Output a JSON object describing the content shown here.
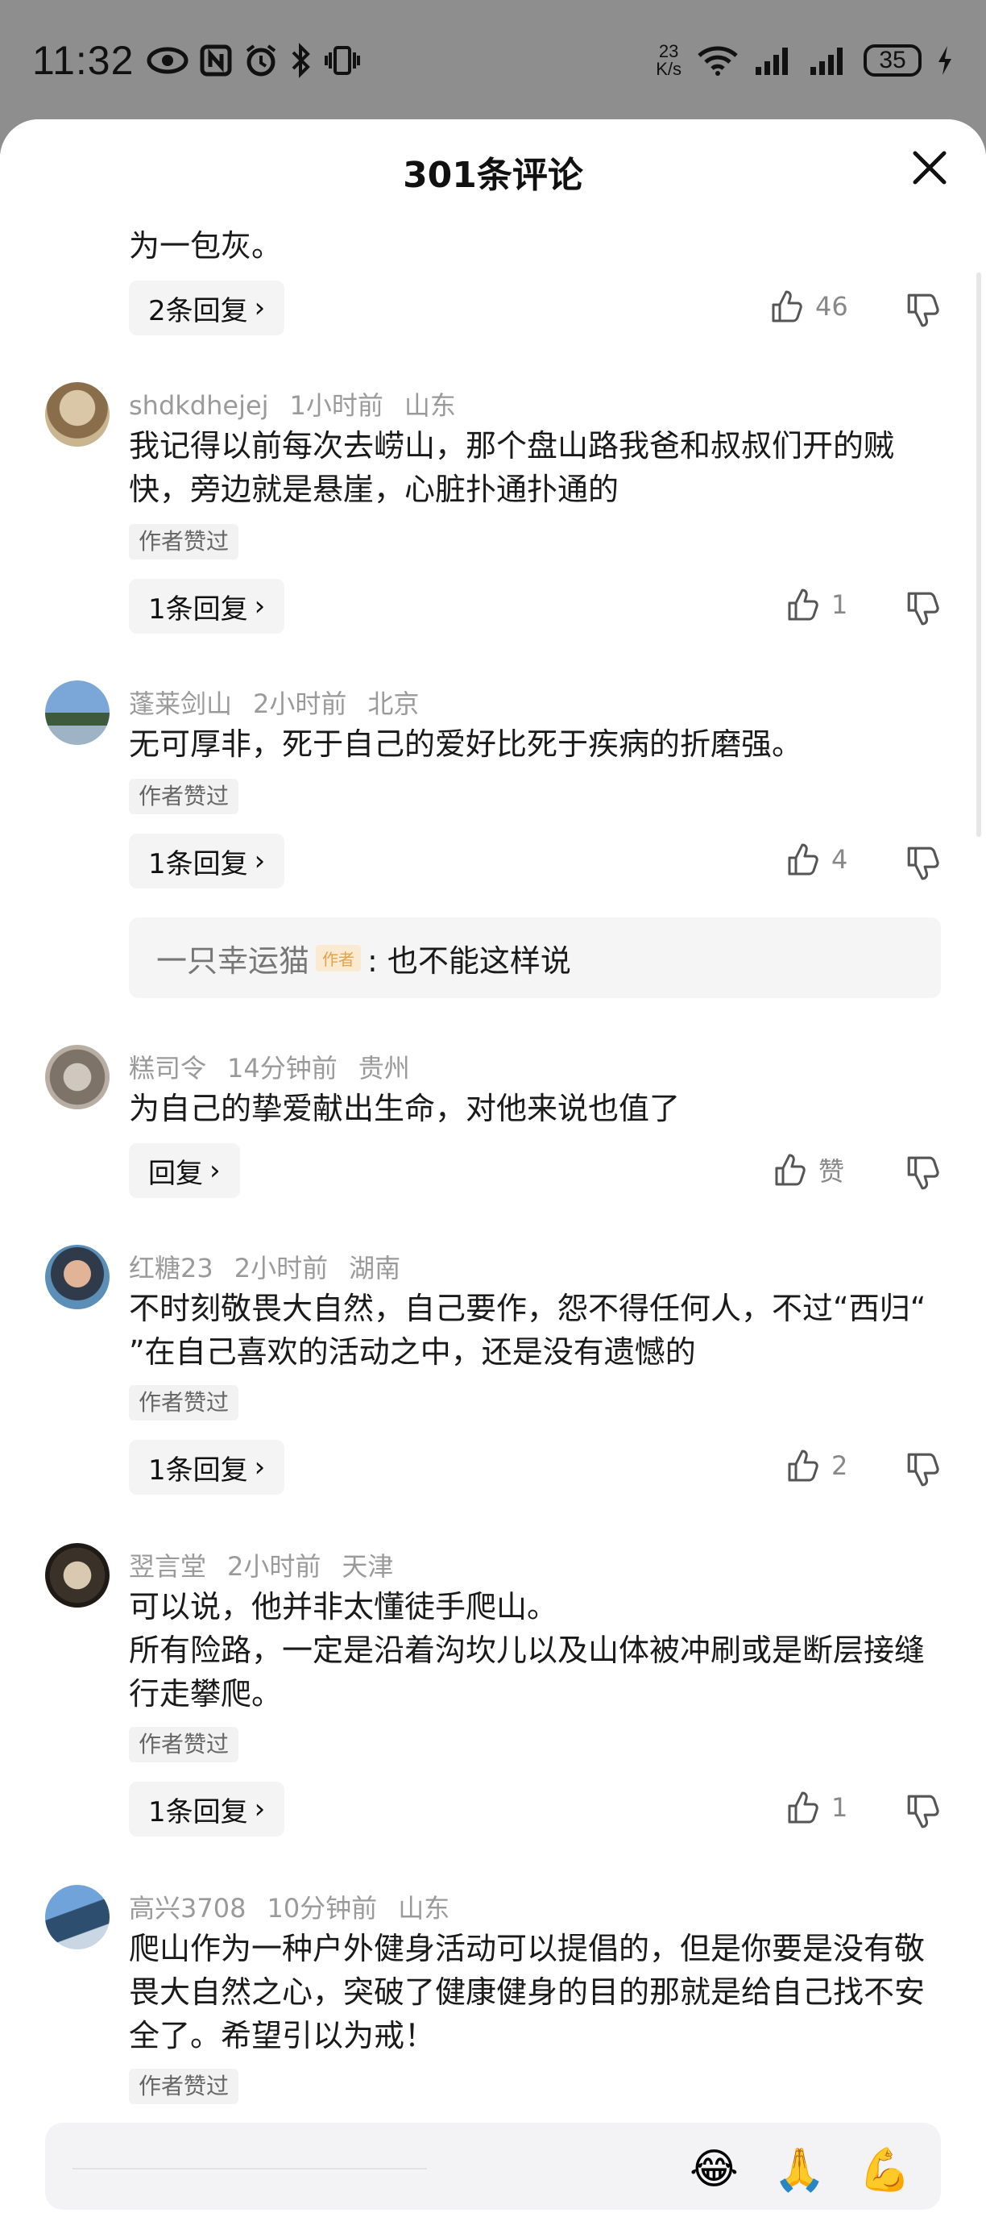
{
  "status": {
    "time": "11:32",
    "speed_value": "23",
    "speed_unit": "K/s",
    "battery": "35"
  },
  "sheet": {
    "title": "301条评论"
  },
  "top_comment": {
    "tail_text": "为一包灰。",
    "replies_label": "2条回复",
    "likes": "46"
  },
  "comments": [
    {
      "user": "shdkdhejej",
      "time": "1小时前",
      "location": "山东",
      "text": "我记得以前每次去崂山，那个盘山路我爸和叔叔们开的贼快，旁边就是悬崖，心脏扑通扑通的",
      "badge": "作者赞过",
      "replies_label": "1条回复",
      "likes": "1"
    },
    {
      "user": "蓬莱剑山",
      "time": "2小时前",
      "location": "北京",
      "text": "无可厚非，死于自己的爱好比死于疾病的折磨强。",
      "badge": "作者赞过",
      "replies_label": "1条回复",
      "likes": "4",
      "sub_reply": {
        "user": "一只幸运猫",
        "tag": "作者",
        "text": ": 也不能这样说"
      }
    },
    {
      "user": "糕司令",
      "time": "14分钟前",
      "location": "贵州",
      "text": "为自己的挚爱献出生命，对他来说也值了",
      "replies_label": "回复",
      "likes": "赞"
    },
    {
      "user": "红糖23",
      "time": "2小时前",
      "location": "湖南",
      "text": "不时刻敬畏大自然，自己要作，怨不得任何人，不过“西归“ ”在自己喜欢的活动之中，还是没有遗憾的",
      "badge": "作者赞过",
      "replies_label": "1条回复",
      "likes": "2"
    },
    {
      "user": "翌言堂",
      "time": "2小时前",
      "location": "天津",
      "text_line1": "可以说，他并非太懂徒手爬山。",
      "text_line2": "所有险路，一定是沿着沟坎儿以及山体被冲刷或是断层接缝行走攀爬。",
      "badge": "作者赞过",
      "replies_label": "1条回复",
      "likes": "1"
    },
    {
      "user": "高兴3708",
      "time": "10分钟前",
      "location": "山东",
      "text": "爬山作为一种户外健身活动可以提倡的，但是你要是没有敬畏大自然之心，突破了健康健身的目的那就是给自己找不安全了。希望引以为戒！",
      "badge": "作者赞过"
    }
  ],
  "input_bar": {
    "emojis": [
      "😂",
      "🙏",
      "💪"
    ]
  },
  "icons": {
    "close": "close-icon",
    "like": "thumbs-up-icon",
    "dislike": "thumbs-down-icon"
  }
}
